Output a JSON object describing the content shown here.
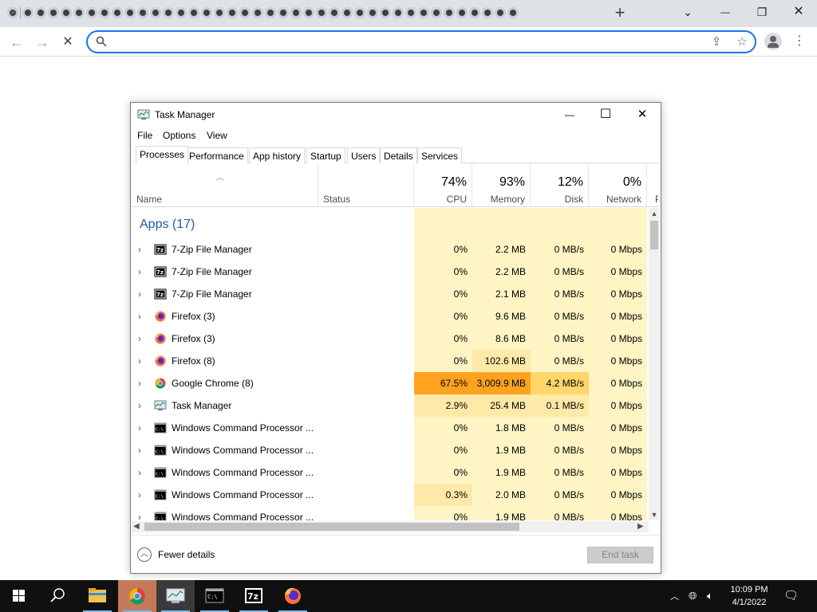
{
  "browser": {
    "new_tab_label": "+",
    "tab_list_label": "⌄",
    "minimize": "—",
    "restore": "❐",
    "close": "✕",
    "back": "←",
    "forward": "→",
    "reload": "✕",
    "omnibox_value": "",
    "share": "⇪",
    "bookmark": "☆",
    "menu": "⋮"
  },
  "task_manager": {
    "title": "Task Manager",
    "controls": {
      "minimize": "—",
      "maximize": "☐",
      "close": "✕"
    },
    "menu": [
      "File",
      "Options",
      "View"
    ],
    "tabs": [
      "Processes",
      "Performance",
      "App history",
      "Startup",
      "Users",
      "Details",
      "Services"
    ],
    "active_tab": "Processes",
    "columns": {
      "name": "Name",
      "status": "Status",
      "cpu": {
        "pct": "74%",
        "label": "CPU"
      },
      "memory": {
        "pct": "93%",
        "label": "Memory"
      },
      "disk": {
        "pct": "12%",
        "label": "Disk"
      },
      "network": {
        "pct": "0%",
        "label": "Network"
      },
      "power": {
        "label": "P"
      }
    },
    "group_label": "Apps (17)",
    "rows": [
      {
        "name": "7-Zip File Manager",
        "icon": "7zip-icon",
        "cpu": "0%",
        "memory": "2.2 MB",
        "disk": "0 MB/s",
        "network": "0 Mbps"
      },
      {
        "name": "7-Zip File Manager",
        "icon": "7zip-icon",
        "cpu": "0%",
        "memory": "2.2 MB",
        "disk": "0 MB/s",
        "network": "0 Mbps"
      },
      {
        "name": "7-Zip File Manager",
        "icon": "7zip-icon",
        "cpu": "0%",
        "memory": "2.1 MB",
        "disk": "0 MB/s",
        "network": "0 Mbps"
      },
      {
        "name": "Firefox (3)",
        "icon": "firefox-icon",
        "cpu": "0%",
        "memory": "9.6 MB",
        "disk": "0 MB/s",
        "network": "0 Mbps"
      },
      {
        "name": "Firefox (3)",
        "icon": "firefox-icon",
        "cpu": "0%",
        "memory": "8.6 MB",
        "disk": "0 MB/s",
        "network": "0 Mbps"
      },
      {
        "name": "Firefox (8)",
        "icon": "firefox-icon",
        "cpu": "0%",
        "memory": "102.6 MB",
        "disk": "0 MB/s",
        "network": "0 Mbps"
      },
      {
        "name": "Google Chrome (8)",
        "icon": "chrome-icon",
        "cpu": "67.5%",
        "memory": "3,009.9 MB",
        "disk": "4.2 MB/s",
        "network": "0 Mbps"
      },
      {
        "name": "Task Manager",
        "icon": "task-manager-icon",
        "cpu": "2.9%",
        "memory": "25.4 MB",
        "disk": "0.1 MB/s",
        "network": "0 Mbps"
      },
      {
        "name": "Windows Command Processor ...",
        "icon": "cmd-icon",
        "cpu": "0%",
        "memory": "1.8 MB",
        "disk": "0 MB/s",
        "network": "0 Mbps"
      },
      {
        "name": "Windows Command Processor ...",
        "icon": "cmd-icon",
        "cpu": "0%",
        "memory": "1.9 MB",
        "disk": "0 MB/s",
        "network": "0 Mbps"
      },
      {
        "name": "Windows Command Processor ...",
        "icon": "cmd-icon",
        "cpu": "0%",
        "memory": "1.9 MB",
        "disk": "0 MB/s",
        "network": "0 Mbps"
      },
      {
        "name": "Windows Command Processor ...",
        "icon": "cmd-icon",
        "cpu": "0.3%",
        "memory": "2.0 MB",
        "disk": "0 MB/s",
        "network": "0 Mbps"
      },
      {
        "name": "Windows Command Processor ...",
        "icon": "cmd-icon",
        "cpu": "0%",
        "memory": "1.9 MB",
        "disk": "0 MB/s",
        "network": "0 Mbps"
      }
    ],
    "footer": {
      "fewer_details": "Fewer details",
      "end_task": "End task"
    }
  },
  "taskbar": {
    "clock_time": "10:09 PM",
    "clock_date": "4/1/2022",
    "apps": [
      "file-explorer",
      "chrome",
      "task-manager",
      "cmd",
      "7zip",
      "firefox"
    ]
  },
  "colors": {
    "heat_light": "#fff4c4",
    "heat_mid": "#ffe9a8",
    "heat_hot": "#ffa21f",
    "heat_warm": "#ffd66b",
    "accent_blue": "#1a73e8"
  }
}
